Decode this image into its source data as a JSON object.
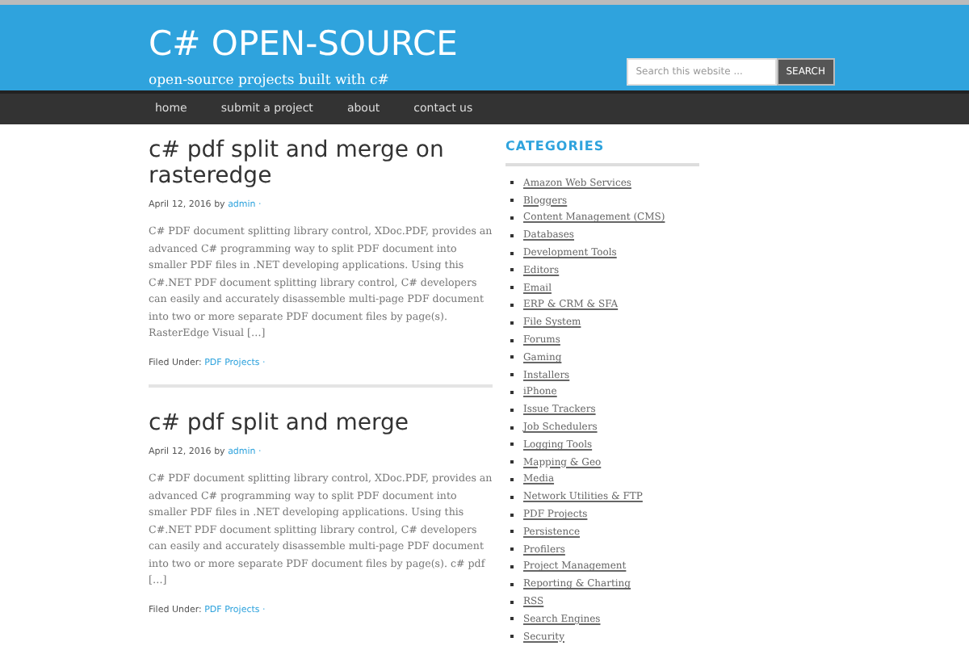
{
  "header": {
    "title": "C# OPEN-SOURCE",
    "tagline": "open-source projects built with c#",
    "search": {
      "placeholder": "Search this website ...",
      "button": "SEARCH"
    }
  },
  "nav": [
    "home",
    "submit a project",
    "about",
    "contact us"
  ],
  "posts": [
    {
      "title": "c# pdf split and merge on rasteredge",
      "date": "April 12, 2016",
      "by": "by",
      "author": "admin",
      "sep": "·",
      "excerpt": "C# PDF document splitting library control, XDoc.PDF, provides an advanced C# programming way to split PDF document into smaller PDF files in .NET developing applications. Using this C#.NET PDF document splitting library control, C# developers can easily and accurately disassemble multi-page PDF document into two or more separate PDF document files by page(s). RasterEdge Visual […]",
      "filed_label": "Filed Under:",
      "category": "PDF Projects",
      "category_sep": "·"
    },
    {
      "title": "c# pdf split and merge",
      "date": "April 12, 2016",
      "by": "by",
      "author": "admin",
      "sep": "·",
      "excerpt": "C# PDF document splitting library control, XDoc.PDF, provides an advanced C# programming way to split PDF document into smaller PDF files in .NET developing applications. Using this C#.NET PDF document splitting library control, C# developers can easily and accurately disassemble multi-page PDF document into two or more separate PDF document files by page(s). c# pdf […]",
      "filed_label": "Filed Under:",
      "category": "PDF Projects",
      "category_sep": "·"
    }
  ],
  "sidebar": {
    "title": "CATEGORIES",
    "items": [
      "Amazon Web Services",
      "Bloggers",
      "Content Management (CMS)",
      "Databases",
      "Development Tools",
      "Editors",
      "Email",
      "ERP & CRM & SFA",
      "File System",
      "Forums",
      "Gaming",
      "Installers",
      "iPhone",
      "Issue Trackers",
      "Job Schedulers",
      "Logging Tools",
      "Mapping & Geo",
      "Media",
      "Network Utilities & FTP",
      "PDF Projects",
      "Persistence",
      "Profilers",
      "Project Management",
      "Reporting & Charting",
      "RSS",
      "Search Engines",
      "Security"
    ]
  }
}
